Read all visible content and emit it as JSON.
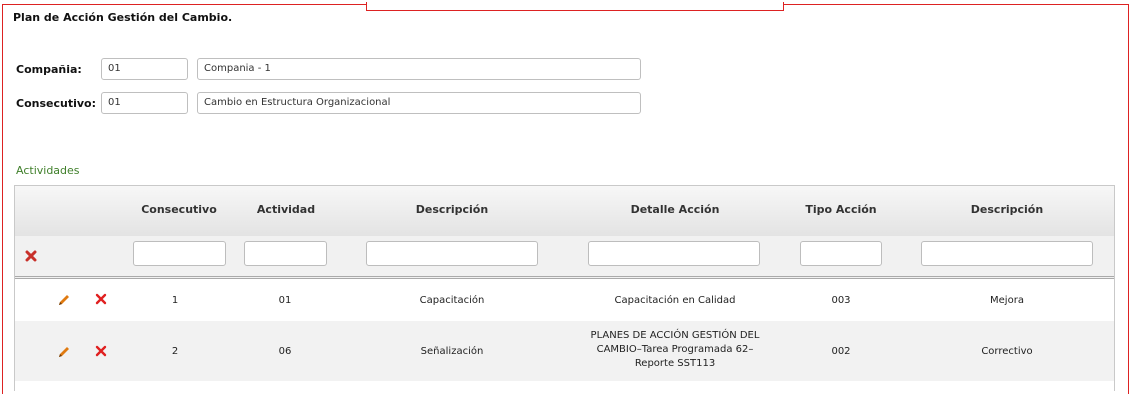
{
  "page": {
    "title": "Plan de Acción Gestión del Cambio."
  },
  "form": {
    "company_label": "Compañia:",
    "company_code": "01",
    "company_name": "Compania - 1",
    "consecutive_label": "Consecutivo:",
    "consecutive_code": "01",
    "consecutive_name": "Cambio en Estructura Organizacional"
  },
  "activities": {
    "section_label": "Actividades",
    "columns": [
      "Consecutivo",
      "Actividad",
      "Descripción",
      "Detalle Acción",
      "Tipo Acción",
      "Descripción"
    ],
    "rows": [
      {
        "consecutivo": "1",
        "actividad": "01",
        "descripcion": "Capacitación",
        "detalle": "Capacitación en Calidad",
        "tipo": "003",
        "tipo_desc": "Mejora"
      },
      {
        "consecutivo": "2",
        "actividad": "06",
        "descripcion": "Señalización",
        "detalle_lines": [
          "PLANES DE ACCIÓN GESTIÓN DEL",
          "CAMBIO–Tarea Programada 62–",
          "Reporte SST113"
        ],
        "tipo": "002",
        "tipo_desc": "Correctivo"
      }
    ]
  },
  "colors": {
    "frame": "#dd2222",
    "section_label": "#3f7f2a",
    "edit_icon": "#e07a10",
    "delete_icon": "#e02020"
  },
  "icons": {
    "clear_filter": "clear-filter-icon",
    "edit": "pencil-icon",
    "delete": "x-icon"
  }
}
